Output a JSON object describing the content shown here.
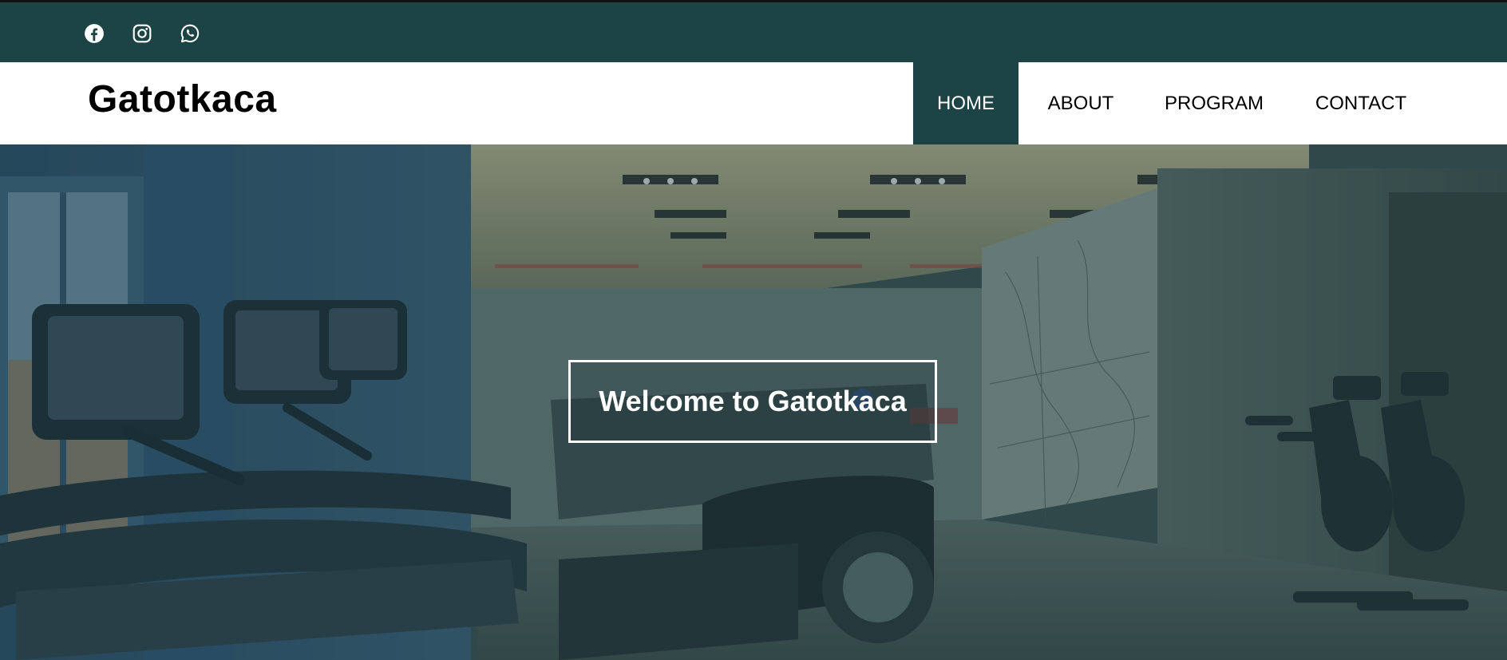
{
  "social": {
    "icons": [
      "facebook-icon",
      "instagram-icon",
      "whatsapp-icon"
    ]
  },
  "header": {
    "brand": "Gatotkaca"
  },
  "nav": {
    "items": [
      {
        "label": "HOME",
        "active": true
      },
      {
        "label": "ABOUT",
        "active": false
      },
      {
        "label": "PROGRAM",
        "active": false
      },
      {
        "label": "CONTACT",
        "active": false
      }
    ]
  },
  "hero": {
    "heading": "Welcome to Gatotkaca"
  },
  "colors": {
    "primary": "#1d4445",
    "header_bg": "#ffffff",
    "text_dark": "#000000",
    "text_light": "#ffffff"
  }
}
